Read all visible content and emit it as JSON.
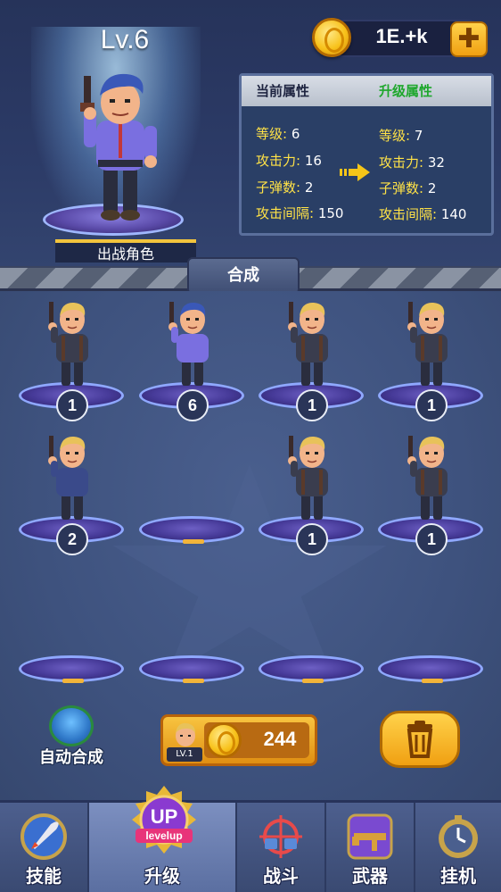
{
  "hero": {
    "level": "Lv.6",
    "caption": "出战角色"
  },
  "currency": {
    "amount": "1E.+k",
    "add_icon": "plus-icon"
  },
  "stats": {
    "current_header": "当前属性",
    "upgrade_header": "升级属性",
    "current": [
      {
        "key": "等级:",
        "value": "6"
      },
      {
        "key": "攻击力:",
        "value": "16"
      },
      {
        "key": "子弹数:",
        "value": "2"
      },
      {
        "key": "攻击间隔:",
        "value": "150"
      }
    ],
    "upgraded": [
      {
        "key": "等级:",
        "value": "7"
      },
      {
        "key": "攻击力:",
        "value": "32"
      },
      {
        "key": "子弹数:",
        "value": "2"
      },
      {
        "key": "攻击间隔:",
        "value": "140"
      }
    ],
    "colors": {
      "upgrade": "#1ea72c",
      "key": "#ffe247"
    }
  },
  "merge_tab": "合成",
  "slots": [
    {
      "level": "1",
      "hero": "blonde"
    },
    {
      "level": "6",
      "hero": "purple"
    },
    {
      "level": "1",
      "hero": "blonde"
    },
    {
      "level": "1",
      "hero": "blonde"
    },
    {
      "level": "2",
      "hero": "blonde-blue"
    },
    {
      "level": "",
      "hero": ""
    },
    {
      "level": "1",
      "hero": "blonde"
    },
    {
      "level": "1",
      "hero": "blonde"
    },
    {
      "level": "",
      "hero": ""
    },
    {
      "level": "",
      "hero": ""
    },
    {
      "level": "",
      "hero": ""
    },
    {
      "level": "",
      "hero": ""
    }
  ],
  "controls": {
    "auto_merge": "自动合成",
    "buy_level": "LV.1",
    "buy_price": "244",
    "trash_icon": "trash-icon"
  },
  "nav": {
    "items": [
      {
        "label": "技能",
        "icon": "rocket-icon"
      },
      {
        "label": "升级",
        "icon": "up-levelup-icon"
      },
      {
        "label": "战斗",
        "icon": "crosshair-guns-icon"
      },
      {
        "label": "武器",
        "icon": "rifle-icon"
      },
      {
        "label": "挂机",
        "icon": "clock-icon"
      }
    ],
    "up_text": "UP",
    "levelup_text": "levelup"
  }
}
